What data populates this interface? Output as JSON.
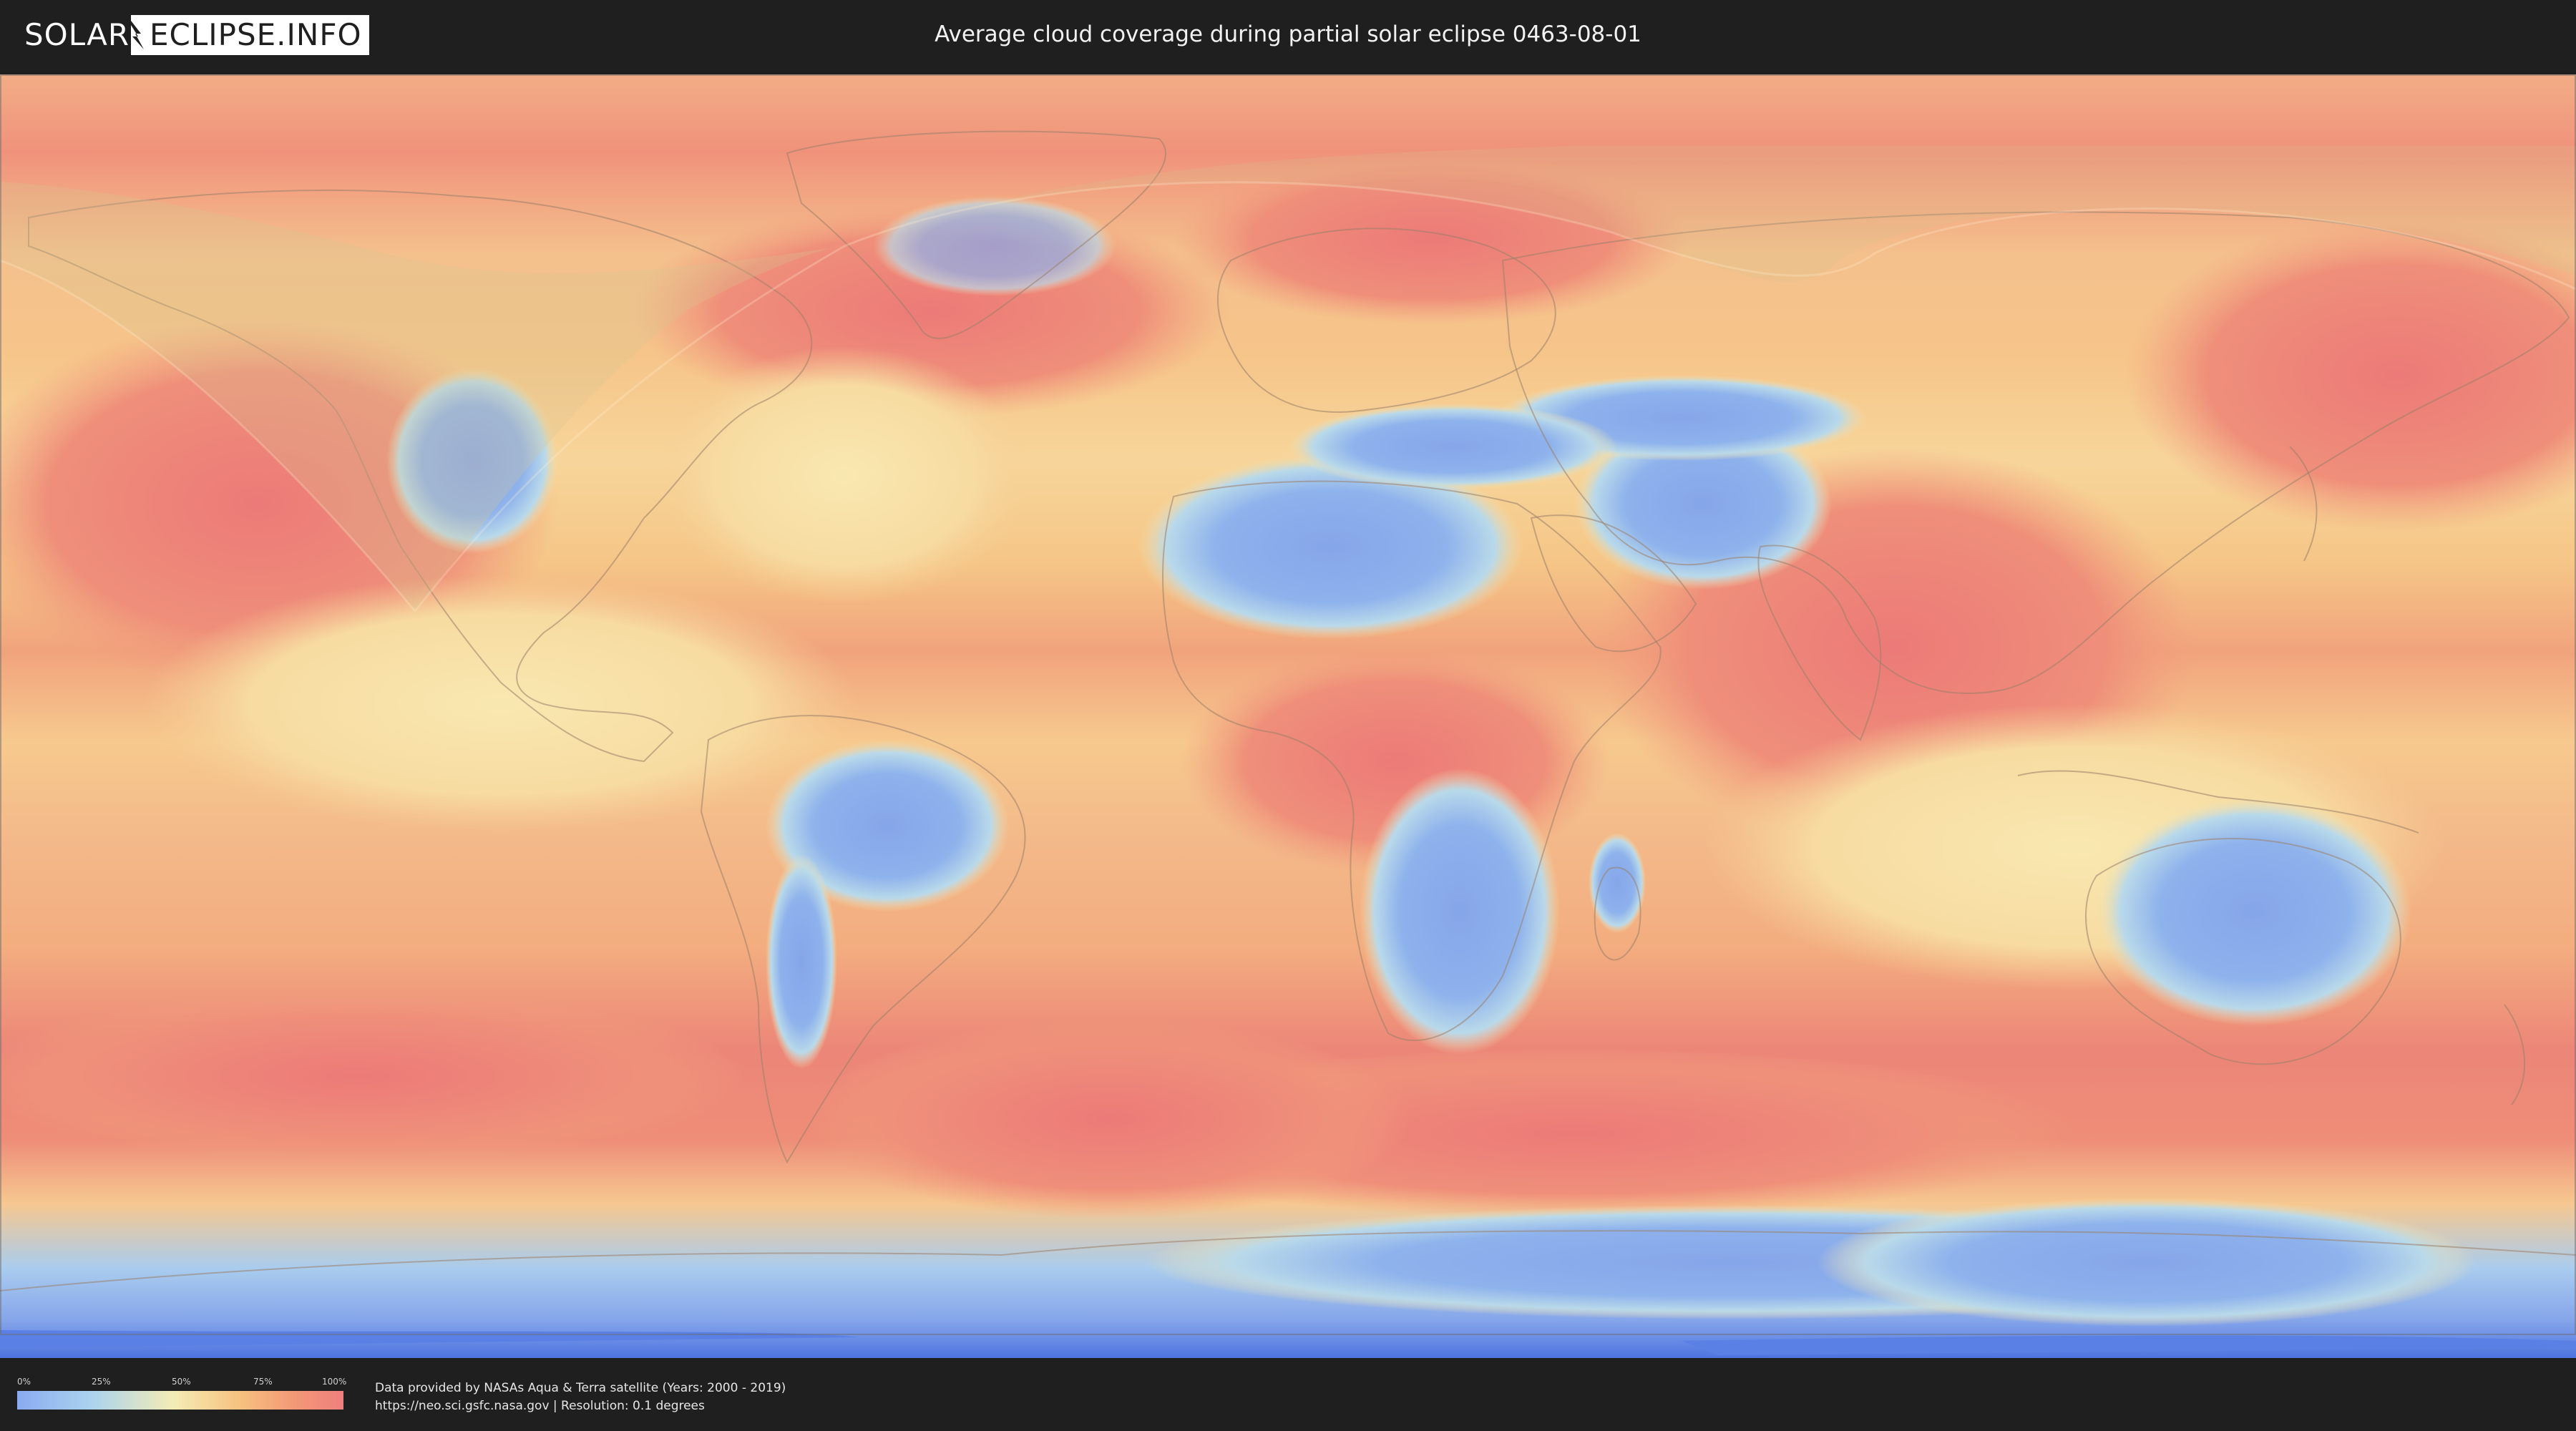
{
  "header": {
    "logo_left": "SOLAR",
    "logo_right": "ECLIPSE.INFO",
    "title": "Average cloud coverage during partial solar eclipse 0463-08-01"
  },
  "map": {
    "layer": "average cloud coverage",
    "palette": {
      "clear": "#86a6ea",
      "low": "#a9d2ee",
      "mid": "#f4ecb6",
      "high": "#f7c27f",
      "very_high": "#ef7f7f",
      "ice": "#5f86e6"
    }
  },
  "legend": {
    "ticks": [
      "0%",
      "25%",
      "50%",
      "75%",
      "100%"
    ],
    "tick_values": [
      0,
      25,
      50,
      75,
      100
    ]
  },
  "footer": {
    "source_line": "Data provided by NASAs Aqua & Terra satellite (Years: 2000 - 2019)",
    "info_line": "https://neo.sci.gsfc.nasa.gov | Resolution: 0.1 degrees"
  }
}
